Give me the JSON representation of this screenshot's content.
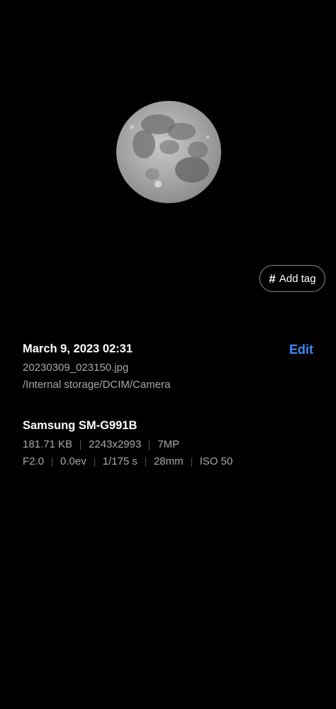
{
  "tag_button": {
    "icon": "hash-icon",
    "label": "Add tag"
  },
  "details": {
    "date": "March 9, 2023 02:31",
    "edit_label": "Edit",
    "filename": "20230309_023150.jpg",
    "path": "/Internal storage/DCIM/Camera",
    "device": "Samsung SM-G991B",
    "file_info": [
      "181.71 KB",
      "2243x2993",
      "7MP"
    ],
    "camera_info": [
      "F2.0",
      "0.0ev",
      "1/175 s",
      "28mm",
      "ISO 50"
    ]
  },
  "colors": {
    "background": "#000000",
    "accent": "#3d8af7",
    "secondary_text": "#a8a8a8"
  }
}
